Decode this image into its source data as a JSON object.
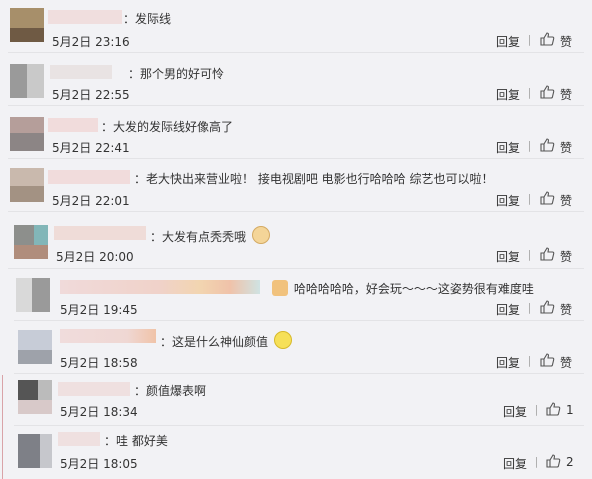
{
  "comments": [
    {
      "text": "：发际线",
      "time": "5月2日 23:16",
      "reply": "回复",
      "like": "赞"
    },
    {
      "text": "：那个男的好可怜",
      "time": "5月2日 22:55",
      "reply": "回复",
      "like": "赞"
    },
    {
      "text": "：大发的发际线好像高了",
      "time": "5月2日 22:41",
      "reply": "回复",
      "like": "赞"
    },
    {
      "text": "：老大快出来营业啦！ 接电视剧吧 电影也行哈哈哈 综艺也可以啦！",
      "time": "5月2日 22:01",
      "reply": "回复",
      "like": "赞"
    },
    {
      "text": "：大发有点秃秃哦",
      "time": "5月2日 20:00",
      "reply": "回复",
      "like": "赞"
    },
    {
      "text": "哈哈哈哈哈，好会玩～～～这姿势很有难度哇",
      "time": "5月2日 19:45",
      "reply": "回复",
      "like": "赞"
    },
    {
      "text": "：这是什么神仙颜值",
      "time": "5月2日 18:58",
      "reply": "回复",
      "like": "赞"
    },
    {
      "text": "：颜值爆表啊",
      "time": "5月2日 18:34",
      "reply": "回复",
      "like": "1"
    },
    {
      "text": "：哇 都好美",
      "time": "5月2日 18:05",
      "reply": "回复",
      "like": "2"
    }
  ],
  "icons": {
    "like": "thumbs-up-icon",
    "separator": "|"
  },
  "colors": {
    "background": "#f2f2f5",
    "text": "#333333",
    "nested_bar": "#d9a3a8"
  }
}
